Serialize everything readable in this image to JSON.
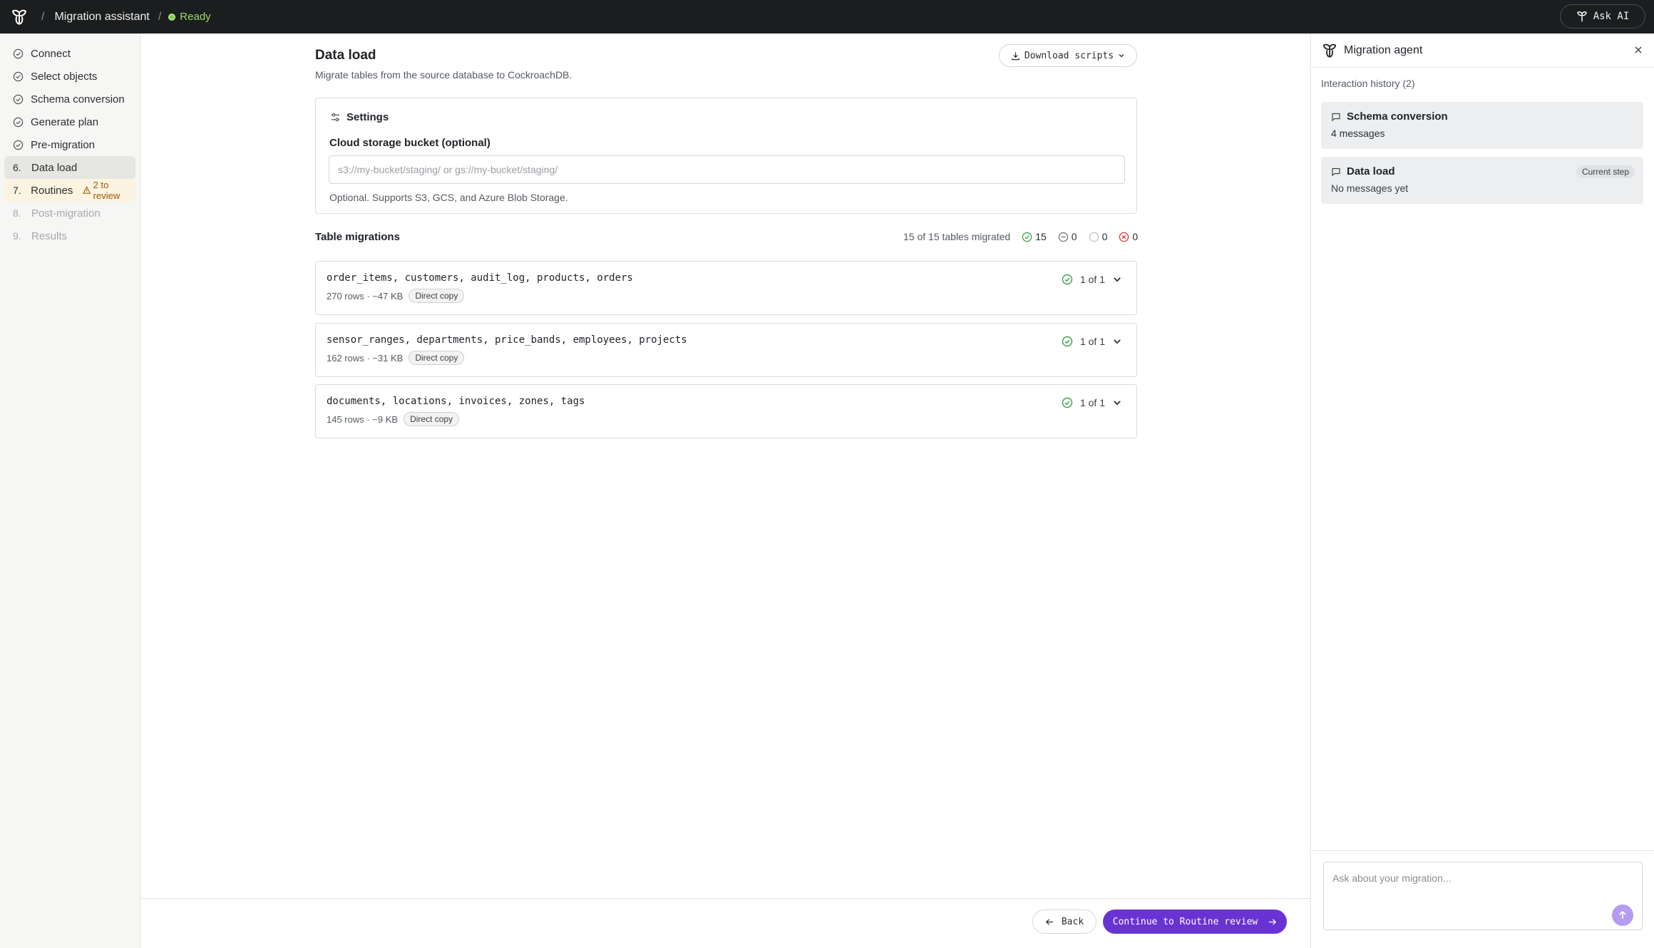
{
  "topbar": {
    "app_title": "Migration assistant",
    "status": "Ready",
    "ask_ai": "Ask AI"
  },
  "sidebar": {
    "steps": [
      {
        "num": "",
        "label": "Connect",
        "state": "done"
      },
      {
        "num": "",
        "label": "Select objects",
        "state": "done"
      },
      {
        "num": "",
        "label": "Schema conversion",
        "state": "done"
      },
      {
        "num": "",
        "label": "Generate plan",
        "state": "done"
      },
      {
        "num": "",
        "label": "Pre-migration",
        "state": "done"
      },
      {
        "num": "6.",
        "label": "Data load",
        "state": "active"
      },
      {
        "num": "7.",
        "label": "Routines",
        "state": "warn",
        "badge": "2 to review"
      },
      {
        "num": "8.",
        "label": "Post-migration",
        "state": "disabled"
      },
      {
        "num": "9.",
        "label": "Results",
        "state": "disabled"
      }
    ]
  },
  "main": {
    "title": "Data load",
    "subtitle": "Migrate tables from the source database to CockroachDB.",
    "download_label": "Download scripts",
    "settings": {
      "heading": "Settings",
      "bucket_label": "Cloud storage bucket (optional)",
      "bucket_placeholder": "s3://my-bucket/staging/ or gs://my-bucket/staging/",
      "bucket_value": "",
      "help": "Optional. Supports S3, GCS, and Azure Blob Storage."
    },
    "table_migrations": {
      "title": "Table migrations",
      "summary": "15 of 15 tables migrated",
      "counts": {
        "success": "15",
        "skipped": "0",
        "pending": "0",
        "failed": "0"
      },
      "groups": [
        {
          "tables": "order_items, customers, audit_log, products, orders",
          "meta": "270 rows · ~47 KB",
          "method": "Direct copy",
          "progress": "1 of 1"
        },
        {
          "tables": "sensor_ranges, departments, price_bands, employees, projects",
          "meta": "162 rows · ~31 KB",
          "method": "Direct copy",
          "progress": "1 of 1"
        },
        {
          "tables": "documents, locations, invoices, zones, tags",
          "meta": "145 rows · ~9 KB",
          "method": "Direct copy",
          "progress": "1 of 1"
        }
      ]
    },
    "footer": {
      "back": "Back",
      "continue": "Continue to Routine review"
    }
  },
  "agent": {
    "title": "Migration agent",
    "history_label": "Interaction history (2)",
    "history": [
      {
        "title": "Schema conversion",
        "sub": "4 messages",
        "current": ""
      },
      {
        "title": "Data load",
        "sub": "No messages yet",
        "current": "Current step"
      }
    ],
    "input_placeholder": "Ask about your migration..."
  },
  "colors": {
    "accent": "#6933d3",
    "success": "#3aa14a",
    "warn": "#9a5b00",
    "topbar": "#1b1d1e"
  }
}
